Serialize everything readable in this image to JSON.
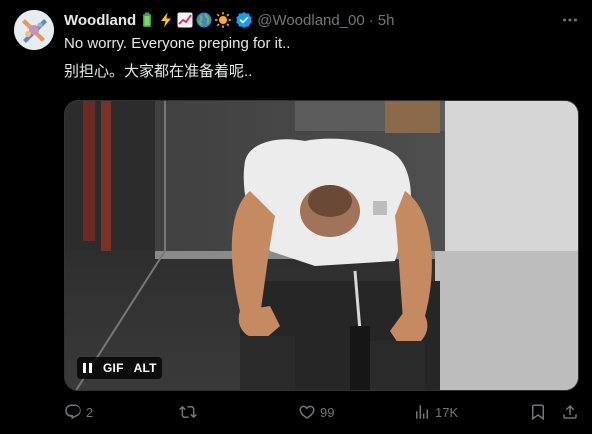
{
  "author": {
    "display_name": "Woodland",
    "handle": "@Woodland_00",
    "separator": "·",
    "time": "5h",
    "emojis": [
      "battery-emoji",
      "lightning-emoji",
      "chart-up-emoji",
      "globe-emoji",
      "sun-emoji"
    ],
    "verified_color": "#1d9bf0"
  },
  "tweet": {
    "line1": "No worry. Everyone preping for it..",
    "line2": "别担心。大家都在准备着呢.."
  },
  "media": {
    "type": "gif",
    "badges": {
      "gif": "GIF",
      "alt": "ALT"
    }
  },
  "actions": {
    "replies": "2",
    "reposts": "",
    "likes": "99",
    "views": "17K"
  },
  "colors": {
    "background": "#000000",
    "text": "#e7e9ea",
    "secondary": "#71767b",
    "accent": "#1d9bf0"
  }
}
